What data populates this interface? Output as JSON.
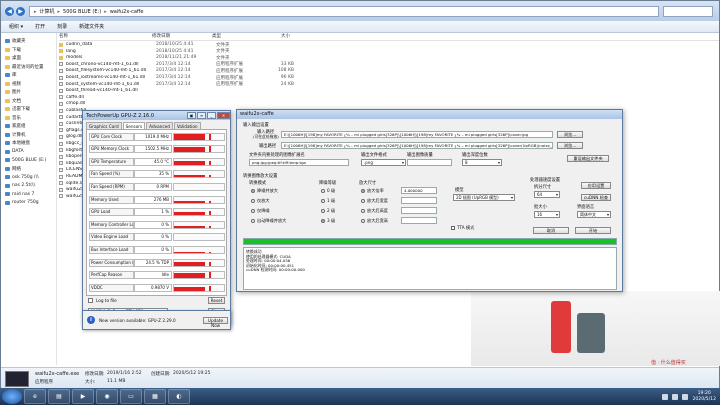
{
  "explorer": {
    "breadcrumbs": [
      "计算机",
      "500G BLUE (E:)",
      "waifu2x-caffe"
    ],
    "toolbar": [
      "组织 ▾",
      "打开",
      "刻录",
      "新建文件夹"
    ],
    "columns": [
      "名称",
      "修改日期",
      "类型",
      "大小"
    ],
    "nav": [
      {
        "label": "收藏夹",
        "icon": "star-icon"
      },
      {
        "label": "下载",
        "icon": "folder-icon"
      },
      {
        "label": "桌面",
        "icon": "folder-icon"
      },
      {
        "label": "最近访问的位置",
        "icon": "folder-icon"
      },
      {
        "label": "库",
        "icon": "library-icon"
      },
      {
        "label": "视频",
        "icon": "folder-icon"
      },
      {
        "label": "图片",
        "icon": "folder-icon"
      },
      {
        "label": "文档",
        "icon": "folder-icon"
      },
      {
        "label": "迅雷下载",
        "icon": "folder-icon"
      },
      {
        "label": "音乐",
        "icon": "folder-icon"
      },
      {
        "label": "家庭组",
        "icon": "homegroup-icon"
      },
      {
        "label": "计算机",
        "icon": "computer-icon"
      },
      {
        "label": "本地磁盘",
        "icon": "drive-icon"
      },
      {
        "label": "DATA",
        "icon": "drive-icon"
      },
      {
        "label": "500G BLUE (E:)",
        "icon": "drive-icon"
      },
      {
        "label": "网络",
        "icon": "network-icon"
      },
      {
        "label": "osk 750g (\\\\",
        "icon": "network-icon"
      },
      {
        "label": "nas 2.5t(\\\\",
        "icon": "network-icon"
      },
      {
        "label": "raid nas 7",
        "icon": "network-icon"
      },
      {
        "label": "router 750g",
        "icon": "network-icon"
      }
    ],
    "files": [
      {
        "name": "cudnn_data",
        "date": "2018/10/25 4:41",
        "type": "文件夹",
        "size": "",
        "kind": "folder"
      },
      {
        "name": "lang",
        "date": "2018/10/25 4:41",
        "type": "文件夹",
        "size": "",
        "kind": "folder"
      },
      {
        "name": "models",
        "date": "2018/11/21 21:49",
        "type": "文件夹",
        "size": "",
        "kind": "folder"
      },
      {
        "name": "boost_chrono-vc140-mt-1_61.dll",
        "date": "2017/3/4 12:14",
        "type": "应用程序扩展",
        "size": "33 KB",
        "kind": "file"
      },
      {
        "name": "boost_filesystem-vc140-mt-1_61.dll",
        "date": "2017/3/4 12:14",
        "type": "应用程序扩展",
        "size": "108 KB",
        "kind": "file"
      },
      {
        "name": "boost_iostreams-vc140-mt-1_61.dll",
        "date": "2017/3/4 12:14",
        "type": "应用程序扩展",
        "size": "96 KB",
        "kind": "file"
      },
      {
        "name": "boost_system-vc140-mt-1_61.dll",
        "date": "2017/3/4 12:14",
        "type": "应用程序扩展",
        "size": "24 KB",
        "kind": "file"
      },
      {
        "name": "boost_thread-vc140-mt-1_61.dll",
        "date": "",
        "type": "",
        "size": "",
        "kind": "file"
      },
      {
        "name": "caffe.dll",
        "date": "",
        "type": "",
        "size": "",
        "kind": "file"
      },
      {
        "name": "cmop.dll",
        "date": "",
        "type": "",
        "size": "",
        "kind": "file"
      },
      {
        "name": "cublas64",
        "date": "",
        "type": "",
        "size": "",
        "kind": "file"
      },
      {
        "name": "cudart64",
        "date": "",
        "type": "",
        "size": "",
        "kind": "file"
      },
      {
        "name": "cusnn64",
        "date": "",
        "type": "",
        "size": "",
        "kind": "file"
      },
      {
        "name": "gflags.dll",
        "date": "",
        "type": "",
        "size": "",
        "kind": "file"
      },
      {
        "name": "glog.dll",
        "date": "",
        "type": "",
        "size": "",
        "kind": "file"
      },
      {
        "name": "libgcc_s_",
        "date": "",
        "type": "",
        "size": "",
        "kind": "file"
      },
      {
        "name": "libgfortran",
        "date": "",
        "type": "",
        "size": "",
        "kind": "file"
      },
      {
        "name": "libopenbl",
        "date": "",
        "type": "",
        "size": "",
        "kind": "file"
      },
      {
        "name": "libquadm",
        "date": "",
        "type": "",
        "size": "",
        "kind": "file"
      },
      {
        "name": "LICENSE",
        "date": "",
        "type": "",
        "size": "",
        "kind": "file"
      },
      {
        "name": "README",
        "date": "",
        "type": "",
        "size": "",
        "kind": "file"
      },
      {
        "name": "sqlite.sp",
        "date": "",
        "type": "",
        "size": "",
        "kind": "file"
      },
      {
        "name": "waifu2x-c",
        "date": "",
        "type": "",
        "size": "",
        "kind": "file"
      },
      {
        "name": "waifu2x-c",
        "date": "",
        "type": "",
        "size": "",
        "kind": "file"
      }
    ],
    "details": {
      "name": "waifu2x-caffe.exe",
      "type": "应用程序",
      "modified_label": "修改日期:",
      "modified": "2019/1/16 2:52",
      "created_label": "创建日期:",
      "created": "2020/5/12 19:25",
      "size_label": "大小:",
      "size": "11.1 MB"
    },
    "watermark": "值 · 什么值得买"
  },
  "gpuz": {
    "title": "TechPowerUp GPU-Z 2.16.0",
    "tabs": [
      "Graphics Card",
      "Sensors",
      "Advanced",
      "Validation"
    ],
    "active_tab": 1,
    "sensors": [
      {
        "label": "GPU Core Clock",
        "value": "1019.0 MHz",
        "level": 0.85
      },
      {
        "label": "GPU Memory Clock",
        "value": "1502.5 MHz",
        "level": 0.9
      },
      {
        "label": "GPU Temperature",
        "value": "45.0 °C",
        "level": 0.55
      },
      {
        "label": "Fan Speed (%)",
        "value": "35 %",
        "level": 0.35
      },
      {
        "label": "Fan Speed (RPM)",
        "value": "0 RPM",
        "level": 0.0
      },
      {
        "label": "Memory Used",
        "value": "276 MB",
        "level": 0.25
      },
      {
        "label": "GPU Load",
        "value": "1 %",
        "level": 0.6
      },
      {
        "label": "Memory Controller Load",
        "value": "0 %",
        "level": 0.3
      },
      {
        "label": "Video Engine Load",
        "value": "0 %",
        "level": 0.05
      },
      {
        "label": "Bus Interface Load",
        "value": "0 %",
        "level": 0.15
      },
      {
        "label": "Power Consumption (%)",
        "value": "24.5 % TDP",
        "level": 0.55
      },
      {
        "label": "PerfCap Reason",
        "value": "Idle",
        "level": 0.9
      },
      {
        "label": "VDDC",
        "value": "0.9870 V",
        "level": 0.7
      }
    ],
    "log_label": "Log to file",
    "reset_label": "Reset",
    "gpu_name": "NVIDIA GeForce GTX 670",
    "close_label": "Close",
    "notify_text": "New version available: GPU-Z 2.29.0",
    "update_label": "Update Now",
    "graph_color": "#e02020"
  },
  "waifu": {
    "title": "waifu2x-caffe",
    "io_title": "输入输出设置",
    "input_label": "输入路径",
    "input_sublabel": "(可在此处拖放)",
    "input_value": "E:\\[1006H]\\[198]my FAVORITE ¿¾ – mi plugged girls[326P]\\[1006H]\\[198]my FAVORITE ¿¾ – mi plugged girls[326P]\\cover.jpg",
    "output_label": "输出路径",
    "output_value": "E:\\[1006H]\\[198]my FAVORITE ¿¾ – mi plugged girls[326P]\\[1006H]\\[198]my FAVORITE ¿¾ – mi plugged girls[326P]\\cover(UpRGB)(noise_scale)(Level1)(x4.000000).png",
    "browse_label": "浏览...",
    "settings_label": "重设输出文件夹",
    "ext_label": "文件夹内要处理的图像扩展名",
    "ext_value": "png:jpg:jpeg:tif:tiff:bmp:tga",
    "outfmt_label": "输出文件格式",
    "outfmt_value": ".png",
    "quality_label": "输出图像质量",
    "depth_label": "输出深度位数",
    "depth_value": "8",
    "conv_title": "转换图像放大设置",
    "mode_title": "转换模式",
    "modes": [
      {
        "label": "降噪并放大",
        "on": true
      },
      {
        "label": "仅放大",
        "on": false
      },
      {
        "label": "仅降噪",
        "on": false
      },
      {
        "label": "自动降噪并放大",
        "on": false
      }
    ],
    "noise_title": "降噪等级",
    "noise": [
      {
        "label": "0 级",
        "on": false
      },
      {
        "label": "1 级",
        "on": false
      },
      {
        "label": "2 级",
        "on": false
      },
      {
        "label": "3 级",
        "on": true
      }
    ],
    "scale_title": "放大尺寸",
    "scales": [
      {
        "label": "放大倍率",
        "on": true,
        "value": "4.000000"
      },
      {
        "label": "放大后宽度",
        "on": false,
        "value": ""
      },
      {
        "label": "放大后高度",
        "on": false,
        "value": ""
      },
      {
        "label": "放大后宽高",
        "on": false,
        "value": ""
      }
    ],
    "model_label": "模型",
    "model_value": "2D 插图 (UpRGB 模型)",
    "tta_label": "TTA 模式",
    "proc_title": "处理器速度设置",
    "split_label": "拆分尺寸",
    "split_value": "64",
    "batch_label": "批大小",
    "batch_value": "16",
    "lang_label": "界面语言",
    "lang_value": "简体中文",
    "app_settings_label": "应用设置",
    "cudnn_label": "cuDNN 检查",
    "cancel_label": "取消",
    "start_label": "开始",
    "progress": 1.0,
    "log": [
      "转换成功",
      "使用的处理器模式: CUDA",
      "处理时间: 00:00:04.036",
      "初始化时间: 00:00:00.451",
      "cuDNN 检测时间: 00:00:00.000"
    ]
  },
  "taskbar": {
    "apps": [
      {
        "name": "ie-icon",
        "glyph": "e"
      },
      {
        "name": "explorer-icon",
        "glyph": "▤"
      },
      {
        "name": "media-icon",
        "glyph": "▶"
      },
      {
        "name": "chrome-icon",
        "glyph": "◉"
      },
      {
        "name": "terminal-icon",
        "glyph": "▭"
      },
      {
        "name": "gpuz-icon",
        "glyph": "▦"
      },
      {
        "name": "waifu-icon",
        "glyph": "◐"
      }
    ],
    "time": "19:20",
    "date": "2020/5/12"
  }
}
